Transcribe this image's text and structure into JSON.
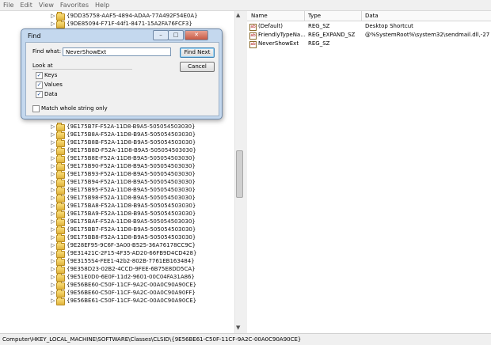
{
  "menu": [
    "File",
    "Edit",
    "View",
    "Favorites",
    "Help"
  ],
  "tree": {
    "top_keys": [
      "{9DD35758-AAF5-4894-ADAA-77A492F54E0A}",
      "{9DE85094-F71F-44f1-8471-15A2FA76FCF3}"
    ],
    "keys": [
      "{9E175B7F-F52A-11D8-B9A5-505054503030}",
      "{9E175B8A-F52A-11D8-B9A5-505054503030}",
      "{9E175B8B-F52A-11D8-B9A5-505054503030}",
      "{9E175B8D-F52A-11D8-B9A5-505054503030}",
      "{9E175B8E-F52A-11D8-B9A5-505054503030}",
      "{9E175B90-F52A-11D8-B9A5-505054503030}",
      "{9E175B93-F52A-11D8-B9A5-505054503030}",
      "{9E175B94-F52A-11D8-B9A5-505054503030}",
      "{9E175B95-F52A-11D8-B9A5-505054503030}",
      "{9E175B98-F52A-11D8-B9A5-505054503030}",
      "{9E175BA8-F52A-11D8-B9A5-505054503030}",
      "{9E175BA9-F52A-11D8-B9A5-505054503030}",
      "{9E175BAF-F52A-11D8-B9A5-505054503030}",
      "{9E175BB7-F52A-11D8-B9A5-505054503030}",
      "{9E175BB8-F52A-11D8-B9A5-505054503030}",
      "{9E28EF95-9C6F-3A00-B525-36A76178CC9C}",
      "{9E31421C-2F15-4F35-AD20-66FB9D4CD428}",
      "{9E3155S4-FEE1-42b2-802B-7761EB163484}",
      "{9E358D23-02B2-4CCD-9FEE-6B75E8DD5CA}",
      "{9E51E0D0-6E0F-11d2-9601-00C04FA31A86}",
      "{9E56BE60-C50F-11CF-9A2C-00A0C90A90CE}",
      "{9E56BE60-C50F-11CF-9A2C-00A0C90A90FF}",
      "{9E56BE61-C50F-11CF-9A2C-00A0C90A90CE}"
    ]
  },
  "values": {
    "columns": [
      "Name",
      "Type",
      "Data"
    ],
    "rows": [
      {
        "icon": "ab",
        "name": "(Default)",
        "type": "REG_SZ",
        "data": "Desktop Shortcut"
      },
      {
        "icon": "ab",
        "name": "FriendlyTypeNa...",
        "type": "REG_EXPAND_SZ",
        "data": "@%SystemRoot%\\system32\\sendmail.dll,-27"
      },
      {
        "icon": "ab",
        "name": "NeverShowExt",
        "type": "REG_SZ",
        "data": ""
      }
    ]
  },
  "status": "Computer\\HKEY_LOCAL_MACHINE\\SOFTWARE\\Classes\\CLSID\\{9E56BE61-C50F-11CF-9A2C-00A0C90A90CE}",
  "find": {
    "title": "Find",
    "find_what_label": "Find what:",
    "find_what_value": "NeverShowExt",
    "look_at_label": "Look at",
    "keys_label": "Keys",
    "values_label": "Values",
    "data_label": "Data",
    "match_label": "Match whole string only",
    "find_next_label": "Find Next",
    "cancel_label": "Cancel",
    "keys_checked": true,
    "values_checked": true,
    "data_checked": true,
    "match_checked": false
  },
  "colors": {
    "folder": "#e0b33c",
    "dialog_frame": "#c4d8ee",
    "close_button": "#c75a45"
  },
  "icons": [
    "expand-arrow-icon",
    "folder-icon",
    "string-value-icon",
    "close-icon",
    "minimize-icon",
    "maximize-icon",
    "checkmark-icon"
  ]
}
